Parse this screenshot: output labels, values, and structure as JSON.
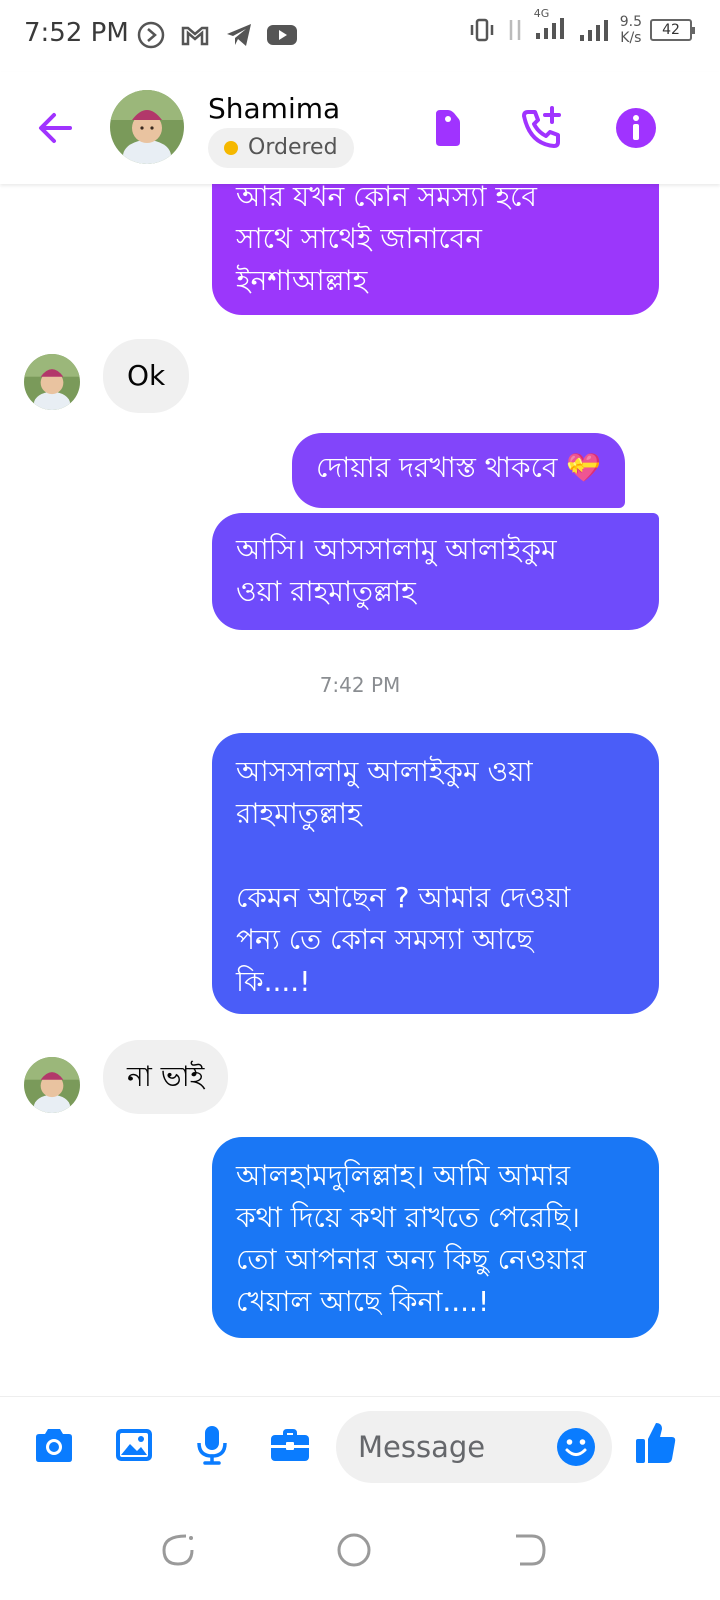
{
  "status_bar": {
    "time": "7:52 PM",
    "network_type": "4G",
    "speed_value": "9.5",
    "speed_unit": "K/s",
    "battery": "42"
  },
  "header": {
    "contact_name": "Shamima",
    "status_label": "Ordered",
    "status_color": "#f5b800",
    "accent_color": "#a033ff"
  },
  "messages": [
    {
      "direction": "out",
      "text": "আর যখন কোন সমস্যা হবে\nসাথে সাথেই জানাবেন\nইনশাআল্লাহ",
      "color": "#9b37fb"
    },
    {
      "direction": "in",
      "text": "Ok"
    },
    {
      "direction": "out",
      "text": "দোয়ার দরখাস্ত থাকবে 💝",
      "color": "#8245fa"
    },
    {
      "direction": "out",
      "text": "আসি। আসসালামু আলাইকুম\nওয়া রাহমাতুল্লাহ",
      "color": "#6f4bfb"
    },
    {
      "direction": "out",
      "text": "আসসালামু আলাইকুম ওয়া\nরাহমাতুল্লাহ\n\nকেমন আছেন ? আমার দেওয়া\nপন্য তে কোন সমস্যা আছে\nকি....!",
      "color": "#4a5df8"
    },
    {
      "direction": "in",
      "text": "না ভাই"
    },
    {
      "direction": "out",
      "text": "আলহামদুলিল্লাহ। আমি আমার\nকথা দিয়ে কথা রাখতে পেরেছি।\nতো  আপনার অন্য কিছু নেওয়ার\nখেয়াল আছে কিনা....!",
      "color": "#1a77f5"
    }
  ],
  "timestamp": "7:42 PM",
  "composer": {
    "placeholder": "Message",
    "accent_color": "#0a7cff"
  },
  "icons": {
    "back": "arrow-left-icon",
    "tag": "tag-icon",
    "call": "phone-plus-icon",
    "info": "info-icon",
    "camera": "camera-icon",
    "gallery": "image-icon",
    "mic": "microphone-icon",
    "briefcase": "briefcase-icon",
    "emoji": "smiley-icon",
    "like": "thumbs-up-icon"
  }
}
